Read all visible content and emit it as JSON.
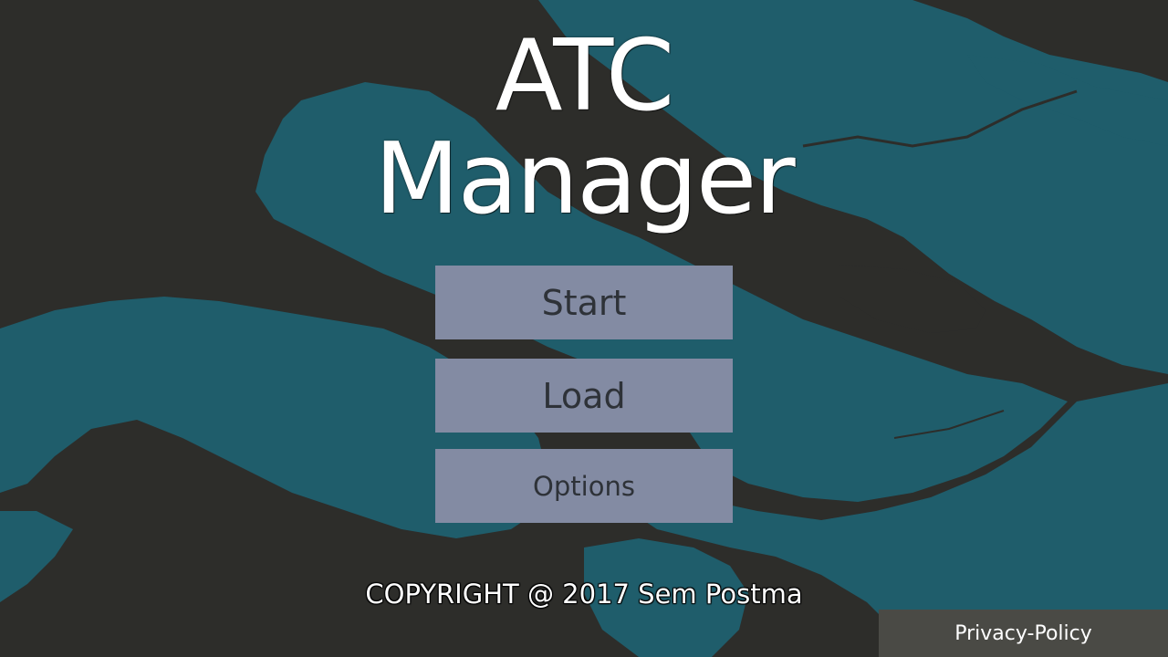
{
  "title": {
    "line1": "ATC",
    "line2": "Manager"
  },
  "menu": {
    "start_label": "Start",
    "load_label": "Load",
    "options_label": "Options"
  },
  "footer": {
    "copyright": "COPYRIGHT @ 2017 Sem Postma",
    "privacy_label": "Privacy-Policy"
  },
  "colors": {
    "land": "#2d2d2a",
    "water": "#1f5d6b",
    "button_bg": "#838ba3",
    "button_text": "#2e3238",
    "privacy_bg": "#4a4a45"
  }
}
